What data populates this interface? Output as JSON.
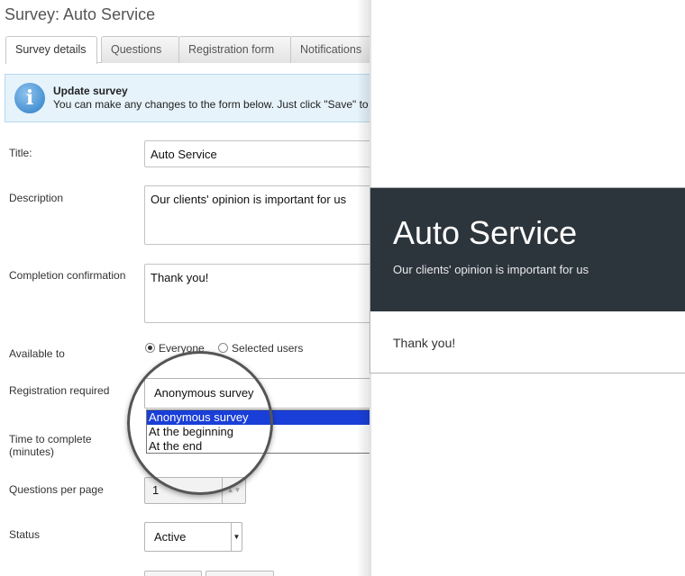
{
  "page": {
    "title": "Survey: Auto Service"
  },
  "tabs": [
    {
      "label": "Survey details",
      "active": true
    },
    {
      "label": "Questions",
      "active": false
    },
    {
      "label": "Registration form",
      "active": false
    },
    {
      "label": "Notifications",
      "active": false
    }
  ],
  "info": {
    "title": "Update survey",
    "text": "You can make any changes to the form below. Just click \"Save\" to"
  },
  "form": {
    "title_label": "Title:",
    "title_value": "Auto Service",
    "description_label": "Description",
    "description_value": "Our clients' opinion is important for us",
    "confirmation_label": "Completion confirmation",
    "confirmation_value": "Thank you!",
    "available_label": "Available to",
    "available_options": [
      "Everyone",
      "Selected users"
    ],
    "registration_label": "Registration required",
    "registration_value": "Anonymous survey",
    "registration_options": [
      "Anonymous survey",
      "At the beginning",
      "At the end"
    ],
    "time_label_line1": "Time to complete",
    "time_label_line2": "(minutes)",
    "questions_per_page_label": "Questions per page",
    "questions_per_page_value": "1",
    "status_label": "Status",
    "status_value": "Active"
  },
  "preview": {
    "title": "Auto Service",
    "description": "Our clients' opinion is important for us",
    "confirmation": "Thank you!"
  },
  "colors": {
    "preview_header": "#2d353c",
    "selected_option": "#1a3fd8",
    "info_background": "#e6f3fb"
  }
}
